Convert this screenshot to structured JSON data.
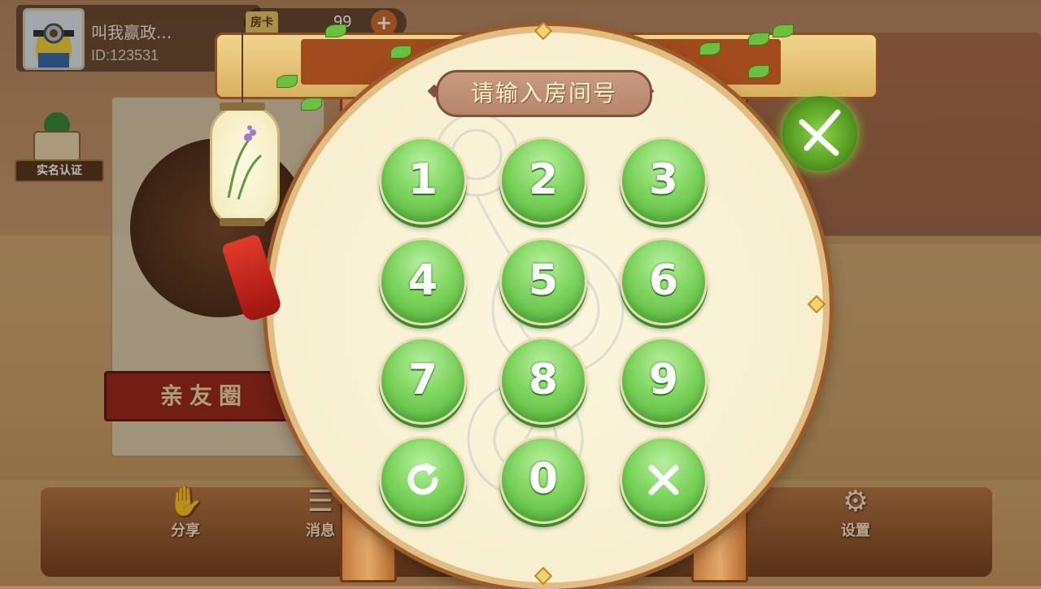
{
  "user": {
    "name": "叫我赢政...",
    "id": "ID:123531",
    "avatar_icon": "minion-avatar"
  },
  "room_card": {
    "tag": "房卡",
    "count": "99",
    "add_label": "+"
  },
  "side": {
    "verify_label": "实名认证"
  },
  "club": {
    "banner": "亲友圈"
  },
  "bottom_bar": {
    "share_label": "分享",
    "message_label": "消息",
    "settings_label": "设置"
  },
  "modal": {
    "title": "请输入房间号",
    "keys": [
      "1",
      "2",
      "3",
      "4",
      "5",
      "6",
      "7",
      "8",
      "9",
      "",
      "0",
      ""
    ],
    "reset_icon": "refresh-icon",
    "delete_icon": "delete-x-icon",
    "close_icon": "close-icon"
  },
  "colors": {
    "key_green": "#7fd45f",
    "title_plate": "#b78469",
    "frame_brown": "#9b5a2a"
  }
}
